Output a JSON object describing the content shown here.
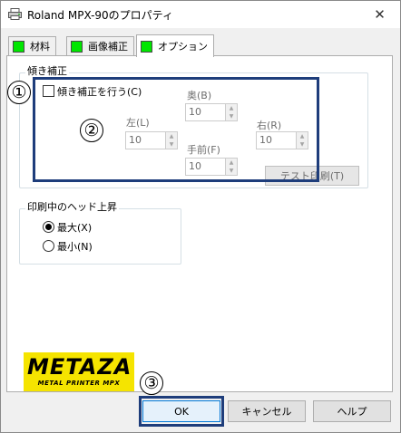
{
  "window": {
    "title": "Roland MPX-90のプロパティ",
    "close_glyph": "✕"
  },
  "tabs": [
    {
      "label": "材料"
    },
    {
      "label": "画像補正"
    },
    {
      "label": "オプション"
    }
  ],
  "tilt_group": {
    "legend": "傾き補正",
    "checkbox_label": "傾き補正を行う(C)",
    "checked": false,
    "back": {
      "label": "奥(B)",
      "value": "10"
    },
    "left": {
      "label": "左(L)",
      "value": "10"
    },
    "right": {
      "label": "右(R)",
      "value": "10"
    },
    "front": {
      "label": "手前(F)",
      "value": "10"
    },
    "test_print_label": "テスト印刷(T)"
  },
  "head_group": {
    "legend": "印刷中のヘッド上昇",
    "options": [
      {
        "label": "最大(X)",
        "selected": true
      },
      {
        "label": "最小(N)",
        "selected": false
      }
    ]
  },
  "logo": {
    "main": "METAZA",
    "sub": "METAL PRINTER MPX"
  },
  "callouts": [
    "①",
    "②",
    "③"
  ],
  "buttons": {
    "ok": "OK",
    "cancel": "キャンセル",
    "help": "ヘルプ"
  },
  "spin_arrows": {
    "up": "▲",
    "down": "▼"
  },
  "colors": {
    "callout": "#1e3d7b",
    "tab_indicator": "#00e600",
    "logo_bg": "#f5e400"
  }
}
